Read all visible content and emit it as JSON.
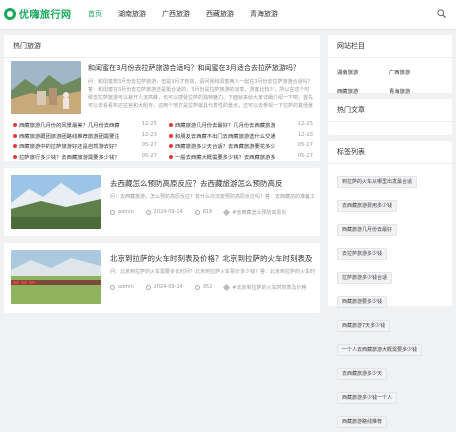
{
  "header": {
    "logo_text": "优嗨旅行网",
    "nav": [
      "首页",
      "湖南旅游",
      "广西旅游",
      "西藏旅游",
      "青海旅游"
    ],
    "active_index": 0,
    "accent": "#1aa85c"
  },
  "hot": {
    "title": "热门旅游",
    "feature": {
      "title": "和闺蜜在3月份去拉萨旅游合适吗？和闺蜜在3月适合去拉萨旅游吗？",
      "desc": "问：和闺蜜想3月份去拉萨旅游，但是3月才有效，请问我和闺蜜两人一起在3月份去拉萨旅游合适吗？答：和闺蜜在3月份去拉萨旅游还是挺合适的，3月份是拉萨旅游的淡季，游客比较少，所以在这个时候去拉萨旅游可以避开人流高峰，也可以感受拉萨的独特魅力。下面就来给大家详细介绍一下吧。首先可以去看看布达拉宫和大昭寺，这两个地方是拉萨最具代表性的景点，还可以去参观一下拉萨的其他景点，比如罗布林卡、哲蚌寺等。"
    },
    "list": [
      {
        "left": "西藏旅游几月份的风景最美？几月份去西藏旅游...",
        "left_date": "12-25",
        "right": "西藏旅游几月份去最好？几月份去西藏旅游最...",
        "right_date": "12-25"
      },
      {
        "left": "西藏旅游跟团旅游团路线推荐旅游团需要注意...",
        "left_date": "12-23",
        "right": "和朋友去西藏不出门去西藏旅游选什么交通...",
        "right_date": "12-23"
      },
      {
        "left": "西藏旅游中的拉萨旅游好还是自驾游去好？",
        "left_date": "05-27",
        "right": "西藏旅游多少天合适？去西藏旅游要花多少...",
        "right_date": "05-27"
      },
      {
        "left": "拉萨旅行多少钱？去西藏旅游需要多少钱？",
        "left_date": "05-27",
        "right": "一般去西藏大概需要多少钱？去西藏旅游多少...",
        "right_date": "05-27"
      }
    ]
  },
  "articles": [
    {
      "title": "去西藏怎么预防高原反应？去西藏旅游怎么预防高反",
      "desc": "问：去西藏旅游，怎么预防高原反应？有什么办法能预防高原反应吗？答：去西藏前的准备工作很重要...",
      "author": "admin",
      "date": "2024-09-14",
      "views": "816",
      "tag": "#去西藏怎么预防高原反"
    },
    {
      "title": "北京到拉萨的火车时刻表及价格？北京到拉萨的火车时刻表及",
      "desc": "问：北京到拉萨的火车需要多长时间？北京到拉萨火车票价多少钱？答：北京到拉萨的火车时刻表及价格...",
      "author": "admin",
      "date": "2024-09-14",
      "views": "952",
      "tag": "#北京到拉萨的火车时刻表及价格"
    }
  ],
  "sidebar": {
    "site_title": "网站栏目",
    "site_links": [
      "湖南旅游",
      "广西旅游",
      "西藏旅游",
      "青海旅游",
      "关于我们",
      "联系我们"
    ],
    "hot_articles_title": "热门文章",
    "tags_title": "标签列表",
    "tags": [
      "到拉萨的火车从哪里出发最合适",
      "去西藏旅游费用多少钱",
      "西藏旅游几月份去最好",
      "去拉萨旅游多少钱",
      "拉萨旅游多少钱合适",
      "西藏旅游要多少钱",
      "西藏旅游7天多少钱",
      "一个人去西藏旅游大概需要多少钱",
      "去西藏旅游多少天",
      "西藏旅游多少钱一个人",
      "西藏旅游路线推荐"
    ]
  }
}
